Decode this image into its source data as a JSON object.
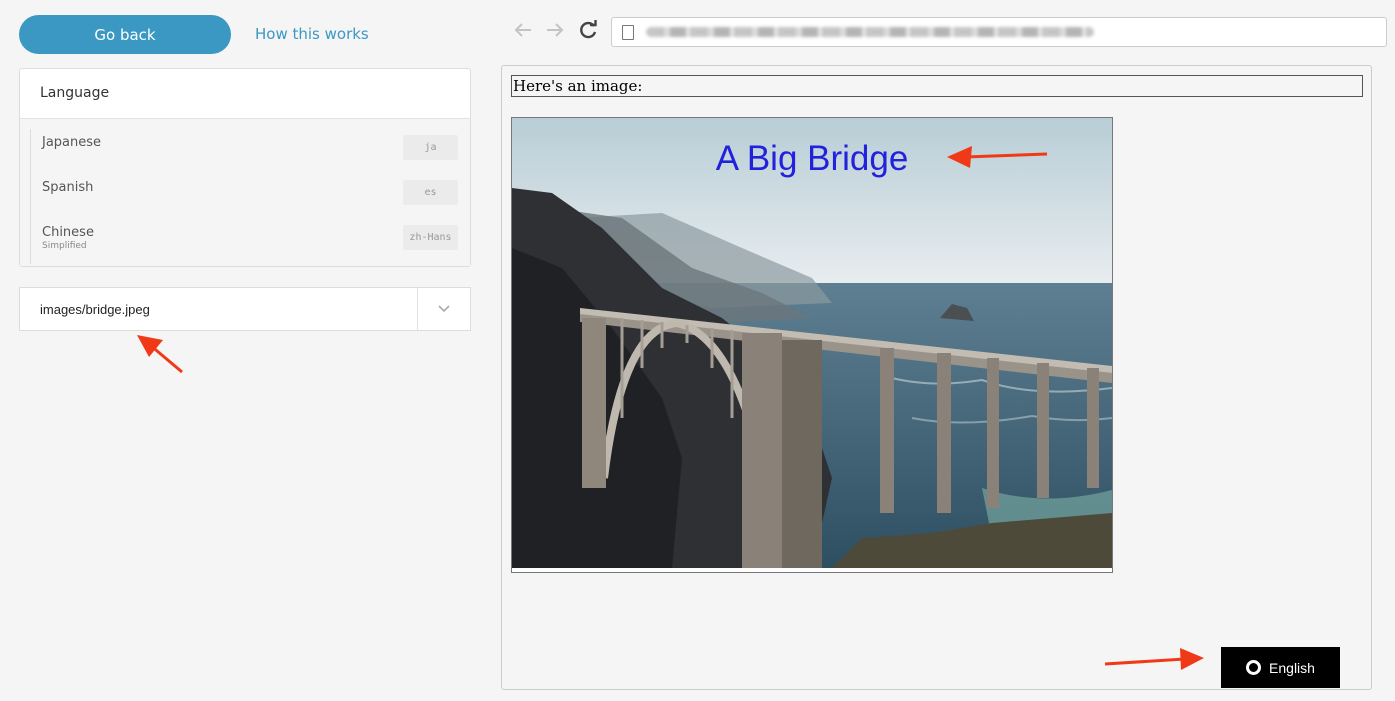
{
  "topbar": {
    "go_back_label": "Go back",
    "how_link_label": "How this works"
  },
  "language_panel": {
    "title": "Language",
    "items": [
      {
        "name": "Japanese",
        "sub": "",
        "code": "ja"
      },
      {
        "name": "Spanish",
        "sub": "",
        "code": "es"
      },
      {
        "name": "Chinese",
        "sub": "Simplified",
        "code": "zh-Hans"
      }
    ]
  },
  "file_select": {
    "value": "images/bridge.jpeg"
  },
  "browser": {
    "back_icon": "arrow-left-icon",
    "forward_icon": "arrow-right-icon",
    "refresh_icon": "refresh-icon",
    "page_icon": "document-icon"
  },
  "preview": {
    "caption": "Here's an image:",
    "image_overlay_text": "A Big Bridge",
    "language_toggle": "English"
  },
  "colors": {
    "accent": "#3a98c3",
    "overlay_text": "#2222dd",
    "annotation_arrow": "#f03a17"
  }
}
